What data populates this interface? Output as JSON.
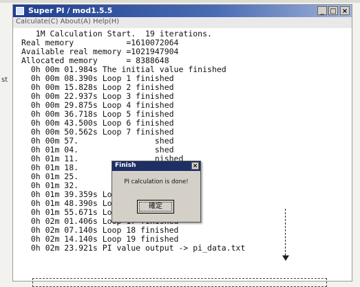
{
  "window": {
    "title": "Super PI / mod1.5.5",
    "menu": "Calculate(C)  About(A)  Help(H)",
    "buttons": {
      "minimize": "_",
      "maximize": "□",
      "close": "×"
    }
  },
  "side_label": "st",
  "console_lines": [
    "   1M Calculation Start.  19 iterations.",
    "Real memory           =1610072064",
    "Available real memory =1021947904",
    "Allocated memory      = 8388648",
    "  0h 00m 01.984s The initial value finished",
    "  0h 00m 08.390s Loop 1 finished",
    "  0h 00m 15.828s Loop 2 finished",
    "  0h 00m 22.937s Loop 3 finished",
    "  0h 00m 29.875s Loop 4 finished",
    "  0h 00m 36.718s Loop 5 finished",
    "  0h 00m 43.500s Loop 6 finished",
    "  0h 00m 50.562s Loop 7 finished",
    "  0h 00m 57.                shed",
    "  0h 01m 04.                shed",
    "  0h 01m 11.                nished",
    "  0h 01m 18.                nished",
    "  0h 01m 25.                nished",
    "  0h 01m 32.                nished",
    "  0h 01m 39.359s Loop 14 finished",
    "  0h 01m 48.390s Loop 15 finished",
    "  0h 01m 55.671s Loop 16 finished",
    "  0h 02m 01.406s Loop 17 finished",
    "  0h 02m 07.140s Loop 18 finished",
    "  0h 02m 14.140s Loop 19 finished",
    "  0h 02m 23.921s PI value output -> pi_data.txt"
  ],
  "dialog": {
    "title": "Finish",
    "close": "×",
    "message": "PI calculation is done!",
    "ok_label": "確定"
  }
}
